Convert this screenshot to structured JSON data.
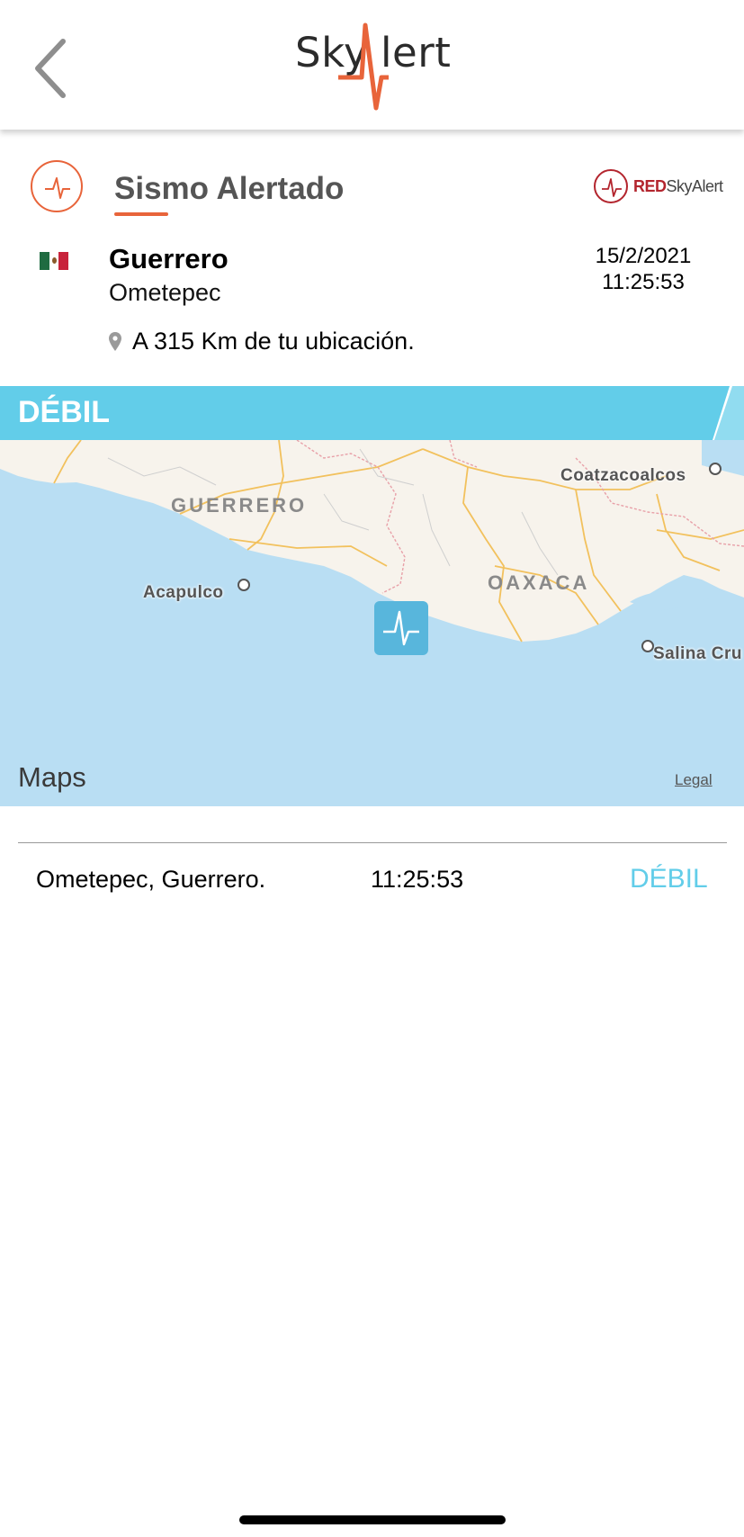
{
  "header": {
    "logo_left": "Sky",
    "logo_right": "lert",
    "logo_color": "#e8643a"
  },
  "alert": {
    "title": "Sismo Alertado",
    "accent_color": "#e8643a",
    "network_logo_red": "RED",
    "network_logo_rest": "SkyAlert"
  },
  "location": {
    "state": "Guerrero",
    "city": "Ometepec",
    "date": "15/2/2021",
    "time": "11:25:53",
    "distance": "A 315 Km de tu ubicación.",
    "flag_icon": "mexico-flag-icon"
  },
  "intensity": {
    "label": "DÉBIL",
    "color": "#62cde9"
  },
  "map": {
    "regions": [
      "GUERRERO",
      "OAXACA"
    ],
    "cities": [
      "Coatzacoalcos",
      "Acapulco",
      "Salina Cru"
    ],
    "brand": "Maps",
    "legal": "Legal"
  },
  "events": [
    {
      "location": "Ometepec, Guerrero.",
      "time": "11:25:53",
      "intensity": "DÉBIL"
    }
  ]
}
